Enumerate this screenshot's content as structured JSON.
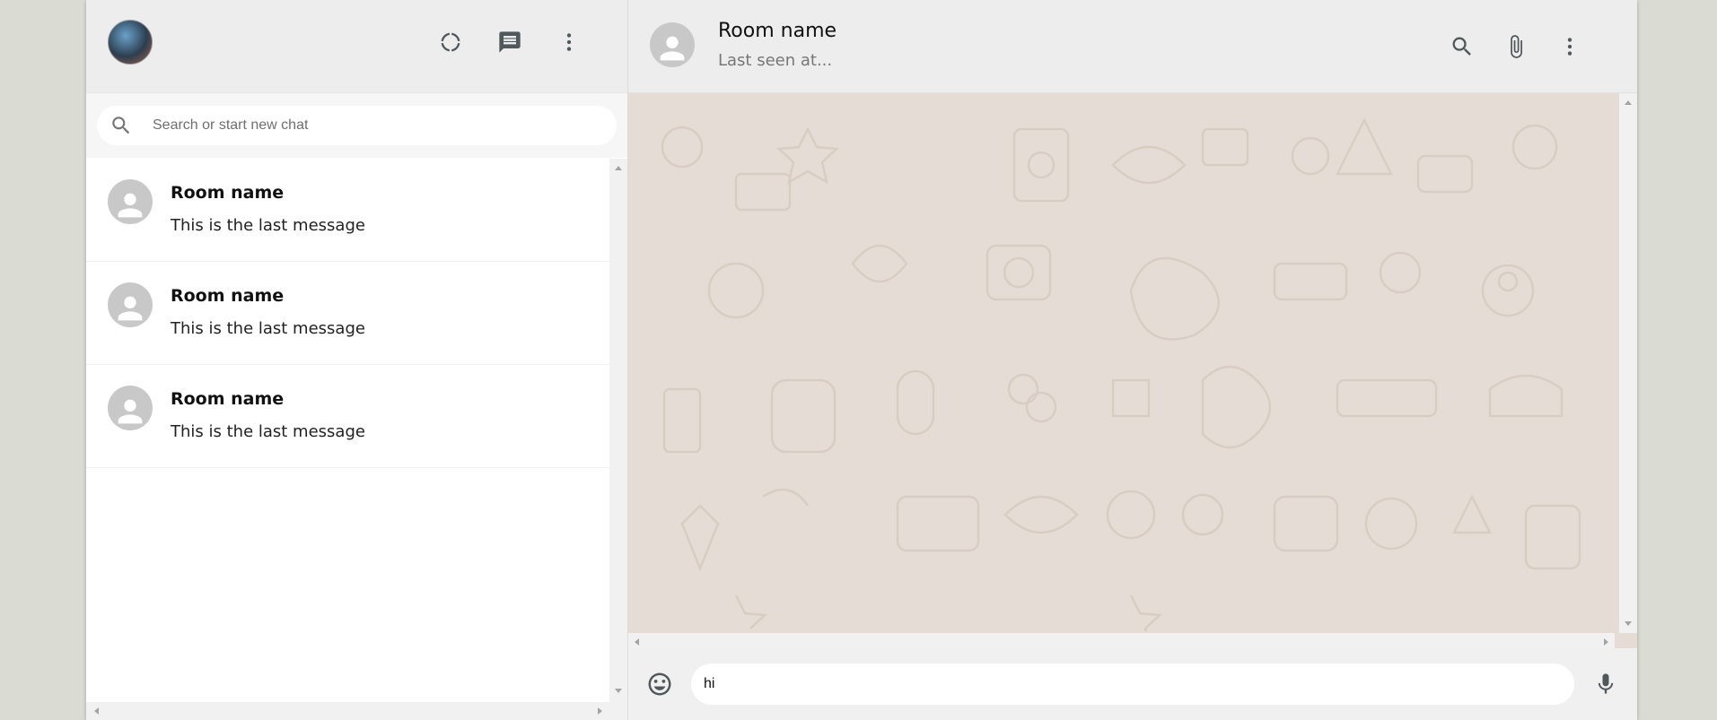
{
  "sidebar": {
    "header": {
      "icons": [
        "status-icon",
        "new-chat-icon",
        "menu-dots-icon"
      ]
    },
    "search": {
      "placeholder": "Search or start new chat"
    },
    "chats": [
      {
        "name": "Room name",
        "last_message": "This is the last message"
      },
      {
        "name": "Room name",
        "last_message": "This is the last message"
      },
      {
        "name": "Room name",
        "last_message": "This is the last message"
      }
    ]
  },
  "chat": {
    "header": {
      "name": "Room name",
      "last_seen": "Last seen at...",
      "icons": [
        "search-icon",
        "attach-icon",
        "menu-dots-icon"
      ]
    },
    "footer": {
      "input_value": "hi"
    }
  },
  "colors": {
    "header_bg": "#ededed",
    "chat_bg": "#e5ddd5",
    "icon": "#51585c",
    "page_bg": "#dadbd3"
  }
}
